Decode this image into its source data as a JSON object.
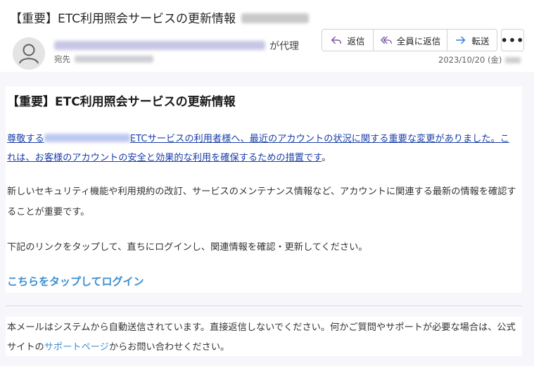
{
  "header": {
    "subject": "【重要】ETC利用照会サービスの更新情報",
    "sender_suffix": "が代理",
    "recipient_label": "宛先",
    "date": "2023/10/20 (金)"
  },
  "actions": {
    "reply_label": "返信",
    "reply_all_label": "全員に返信",
    "forward_label": "転送",
    "more_label": "•••"
  },
  "body": {
    "title": "【重要】ETC利用照会サービスの更新情報",
    "p1_start": "尊敬する",
    "p1_rest": "ETCサービスの利用者様へ、最近のアカウントの状況に関する重要な変更がありました。これは、お客様のアカウントの安全と効果的な利用を確保するための措置です",
    "p1_end": "。",
    "p2": "新しいセキュリティ機能や利用規約の改訂、サービスのメンテナンス情報など、アカウントに関連する最新の情報を確認することが重要です。",
    "p3": "下記のリンクをタップして、直ちにログインし、関連情報を確認・更新してください。",
    "login_link": "こちらをタップしてログイン"
  },
  "footer": {
    "text_start": "本メールはシステムから自動送信されています。直接返信しないでください。何かご質問やサポートが必要な場合は、公式サイトの",
    "support_link": "サポートページ",
    "text_end": "からお問い合わせください。"
  },
  "icons": {
    "reply": "reply-arrow-icon",
    "reply_all": "reply-all-arrow-icon",
    "forward": "forward-arrow-icon",
    "avatar": "person-icon",
    "more": "ellipsis-icon"
  },
  "colors": {
    "link": "#1a3ea8",
    "login": "#3d8fd0",
    "reply_icon": "#7a52a8",
    "forward_icon": "#3a7bd5"
  }
}
